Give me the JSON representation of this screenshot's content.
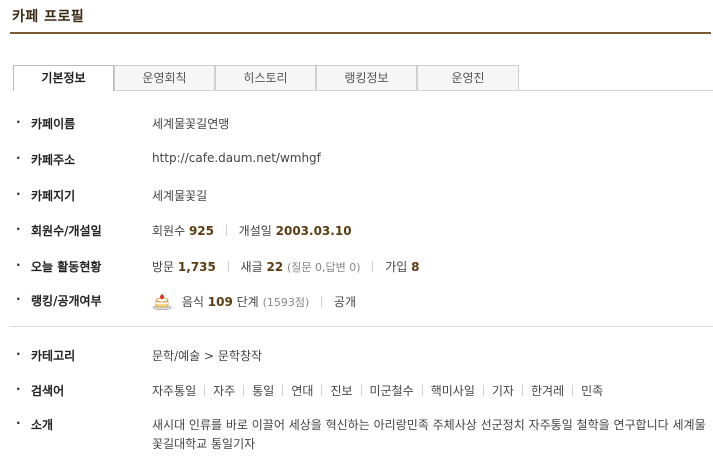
{
  "page": {
    "title": "카페 프로필"
  },
  "tabs": [
    {
      "label": "기본정보"
    },
    {
      "label": "운영회칙"
    },
    {
      "label": "히스토리"
    },
    {
      "label": "랭킹정보"
    },
    {
      "label": "운영진"
    }
  ],
  "bullet": "·",
  "fields": {
    "name": {
      "label": "카페이름",
      "value": "세계물꽃길연맹"
    },
    "url": {
      "label": "카페주소",
      "value": "http://cafe.daum.net/wmhgf"
    },
    "manager": {
      "label": "카페지기",
      "value": "세계물꽃길"
    },
    "members": {
      "label": "회원수/개설일",
      "members_prefix": "회원수",
      "members_count": "925",
      "open_prefix": "개설일",
      "open_date": "2003.03.10"
    },
    "activity": {
      "label": "오늘 활동현황",
      "visit_prefix": "방문",
      "visit_count": "1,735",
      "post_prefix": "새글",
      "post_count": "22",
      "post_detail": "(질문 0,답변 0)",
      "join_prefix": "가입",
      "join_count": "8"
    },
    "ranking": {
      "label": "랭킹/공개여부",
      "category": "음식",
      "rank_num": "109",
      "rank_suffix": "단계",
      "points": "(1593점)",
      "visibility": "공개"
    },
    "category": {
      "label": "카테고리",
      "value": "문학/예술 > 문학창작"
    },
    "keywords": {
      "label": "검색어",
      "items": [
        "자주통일",
        "자주",
        "통일",
        "연대",
        "진보",
        "미군철수",
        "핵미사일",
        "기자",
        "한겨레",
        "민족"
      ]
    },
    "intro": {
      "label": "소개",
      "value": "새시대 인류를 바로 이끌어 세상을 혁신하는 아리랑민족 주체사상 선군정치 자주통일 철학을 연구합니다 세계물꽃길대학교 통일기자"
    }
  },
  "colors": {
    "accent": "#7a5a2e",
    "number": "#5a3d12"
  },
  "icons": {
    "ranking": "cake-icon"
  }
}
